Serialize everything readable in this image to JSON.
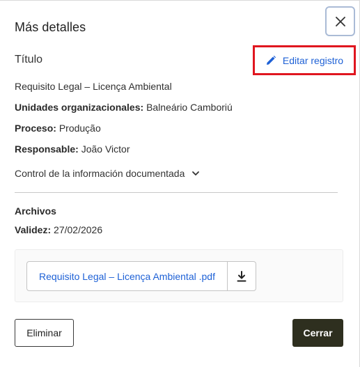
{
  "dialog": {
    "title": "Más detalles",
    "close_icon": "close-icon"
  },
  "record": {
    "title_label": "Título",
    "edit_label": "Editar registro",
    "edit_icon": "pencil-icon",
    "name": "Requisito Legal – Licença Ambiental",
    "units_label": "Unidades organizacionales:",
    "units_value": "Balneário Camboriú",
    "process_label": "Proceso:",
    "process_value": "Produção",
    "responsible_label": "Responsable:",
    "responsible_value": "João Victor",
    "control_label": "Control de la información documentada",
    "control_icon": "chevron-down-icon"
  },
  "files": {
    "heading": "Archivos",
    "validity_label": "Validez:",
    "validity_value": "27/02/2026",
    "items": [
      {
        "name": "Requisito Legal – Licença Ambiental .pdf",
        "action_icon": "download-icon"
      }
    ]
  },
  "footer": {
    "delete_label": "Eliminar",
    "close_label": "Cerrar"
  },
  "colors": {
    "link": "#1e61d6",
    "highlight": "#e0161f",
    "primary_button": "#2e2f1f",
    "close_border": "#aabbd6"
  }
}
